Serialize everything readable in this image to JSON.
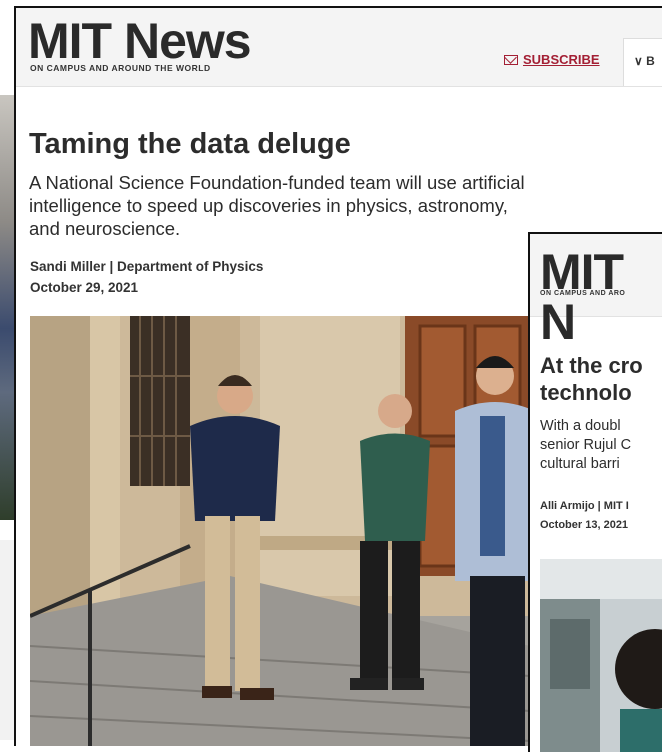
{
  "main": {
    "logo": "MIT News",
    "tagline": "ON CAMPUS AND AROUND THE WORLD",
    "subscribe_label": "SUBSCRIBE",
    "browse_label": "∨ B",
    "title": "Taming the data deluge",
    "dek_lines": [
      "A National Science Foundation-funded team will use artificial",
      "intelligence to speed up discoveries in physics, astronomy,",
      "and neuroscience."
    ],
    "byline": "Sandi Miller | Department of Physics",
    "date": "October 29, 2021"
  },
  "second": {
    "logo": "MIT N",
    "tagline": "ON CAMPUS AND ARO",
    "title_lines": [
      "At the cro",
      "technolo"
    ],
    "dek_lines": [
      "With a doubl",
      "senior Rujul C",
      "cultural barri"
    ],
    "byline": "Alli Armijo | MIT I",
    "date": "October 13, 2021"
  },
  "colors": {
    "accent": "#a31f34",
    "header_bg": "#f4f4f4",
    "text": "#2c2c2c"
  },
  "icons": {
    "subscribe": "mail-icon",
    "browse": "chevron-down-icon"
  }
}
